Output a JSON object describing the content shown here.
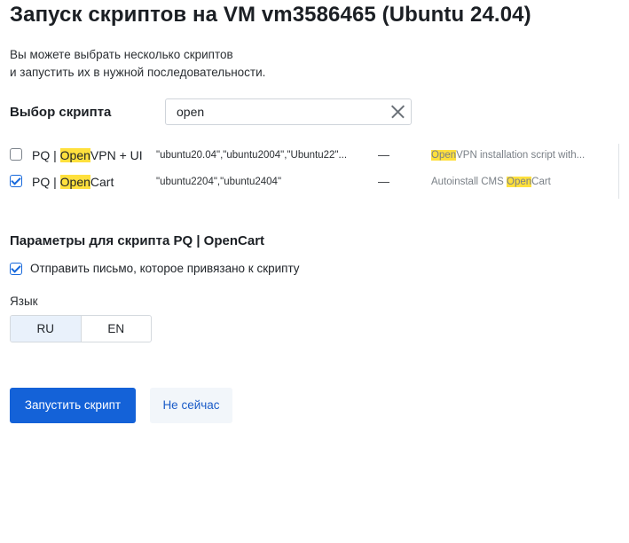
{
  "title": "Запуск скриптов на VM vm3586465 (Ubuntu 24.04)",
  "description": {
    "line1": "Вы можете выбрать несколько скриптов",
    "line2": "и запустить их в нужной последовательности."
  },
  "script_select": {
    "label": "Выбор скрипта",
    "search_value": "open"
  },
  "scripts": [
    {
      "checked": false,
      "name_prefix": "PQ | ",
      "name_match": "Open",
      "name_suffix": "VPN + UI",
      "os": "\"ubuntu20.04\",\"ubuntu2004\",\"Ubuntu22\"...",
      "dash": "—",
      "desc_prefix": "",
      "desc_match": "Open",
      "desc_suffix": "VPN installation script with..."
    },
    {
      "checked": true,
      "name_prefix": "PQ | ",
      "name_match": "Open",
      "name_suffix": "Cart",
      "os": "\"ubuntu2204\",\"ubuntu2404\"",
      "dash": "—",
      "desc_prefix": "Autoinstall CMS ",
      "desc_match": "Open",
      "desc_suffix": "Cart"
    }
  ],
  "params": {
    "title": "Параметры для скрипта PQ | OpenCart",
    "notify_label": "Отправить письмо, которое привязано к скрипту",
    "notify_checked": true,
    "language_label": "Язык",
    "languages": [
      "RU",
      "EN"
    ],
    "selected_language": "RU"
  },
  "buttons": {
    "run": "Запустить скрипт",
    "later": "Не сейчас"
  },
  "colors": {
    "primary": "#1462d8",
    "highlight": "#ffe03d",
    "checkbox": "#1668dc"
  }
}
